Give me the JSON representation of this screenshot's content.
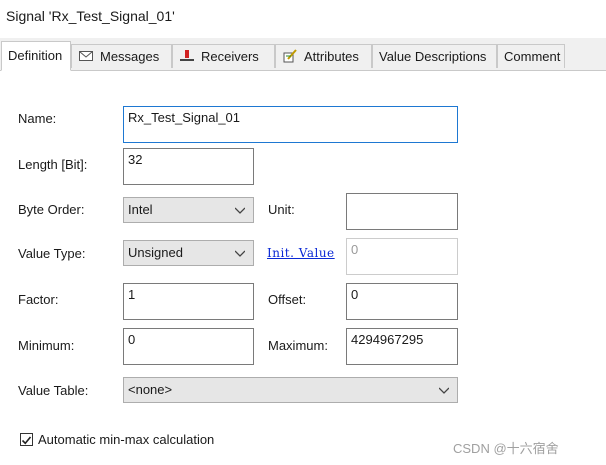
{
  "window": {
    "title": "Signal 'Rx_Test_Signal_01'"
  },
  "tabs": [
    {
      "label": "Definition",
      "icon": "none"
    },
    {
      "label": "Messages",
      "icon": "envelope-icon"
    },
    {
      "label": "Receivers",
      "icon": "receiver-icon"
    },
    {
      "label": "Attributes",
      "icon": "attributes-icon"
    },
    {
      "label": "Value Descriptions",
      "icon": "none"
    },
    {
      "label": "Comment",
      "icon": "none"
    }
  ],
  "form": {
    "name_label": "Name:",
    "name_value": "Rx_Test_Signal_01",
    "length_label": "Length [Bit]:",
    "length_value": "32",
    "byte_order_label": "Byte Order:",
    "byte_order_value": "Intel",
    "unit_label": "Unit:",
    "unit_value": "",
    "value_type_label": "Value Type:",
    "value_type_value": "Unsigned",
    "init_value_link": "Init. Value",
    "init_value_value": "0",
    "factor_label": "Factor:",
    "factor_value": "1",
    "offset_label": "Offset:",
    "offset_value": "0",
    "minimum_label": "Minimum:",
    "minimum_value": "0",
    "maximum_label": "Maximum:",
    "maximum_value": "4294967295",
    "value_table_label": "Value Table:",
    "value_table_value": "<none>",
    "auto_minmax_label": "Automatic min-max calculation",
    "auto_minmax_checked": true
  },
  "watermark": "CSDN @十六宿舍",
  "colors": {
    "focus_border": "#1e78d2",
    "link": "#0a28d6",
    "tab_bg": "#f0f0f0",
    "combo_bg": "#e6e6e6"
  }
}
